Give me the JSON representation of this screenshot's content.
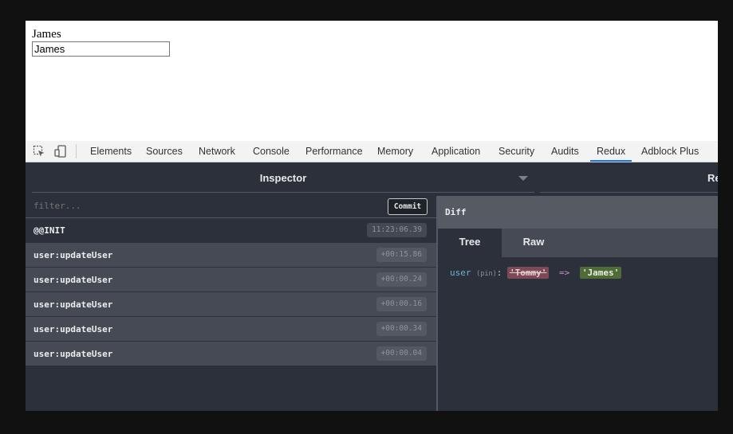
{
  "page": {
    "heading_text": "James",
    "input_value": "James"
  },
  "devtools": {
    "toolbar_icons": [
      "inspect-element-icon",
      "device-toolbar-icon"
    ],
    "tabs": [
      {
        "label": "Elements"
      },
      {
        "label": "Sources"
      },
      {
        "label": "Network"
      },
      {
        "label": "Console"
      },
      {
        "label": "Performance"
      },
      {
        "label": "Memory"
      },
      {
        "label": "Application"
      },
      {
        "label": "Security"
      },
      {
        "label": "Audits"
      },
      {
        "label": "Redux"
      },
      {
        "label": "Adblock Plus"
      }
    ],
    "active_tab": "Redux"
  },
  "redux": {
    "monitor_label": "Inspector",
    "right_monitor_label": "Re",
    "filter_placeholder": "filter...",
    "commit_label": "Commit",
    "actions": [
      {
        "name": "@@INIT",
        "time": "11:23:06.39"
      },
      {
        "name": "user:updateUser",
        "time": "+00:15.86"
      },
      {
        "name": "user:updateUser",
        "time": "+00:00.24"
      },
      {
        "name": "user:updateUser",
        "time": "+00:00.16"
      },
      {
        "name": "user:updateUser",
        "time": "+00:00.34"
      },
      {
        "name": "user:updateUser",
        "time": "+00:00.04"
      }
    ],
    "diff": {
      "title": "Diff",
      "tabs": [
        {
          "label": "Tree"
        },
        {
          "label": "Raw"
        }
      ],
      "active_tab": "Tree",
      "entry": {
        "key": "user",
        "pin_label": "(pin)",
        "colon": ":",
        "old_value": "'Tommy'",
        "arrow": "=>",
        "new_value": "'James'"
      }
    }
  },
  "colors": {
    "panel_bg": "#2b303b",
    "accent_tab_underline": "#1a73e8",
    "removed_value_bg": "#7b4a56",
    "added_value_bg": "#4f6b37",
    "key_color": "#6fb3d2"
  }
}
